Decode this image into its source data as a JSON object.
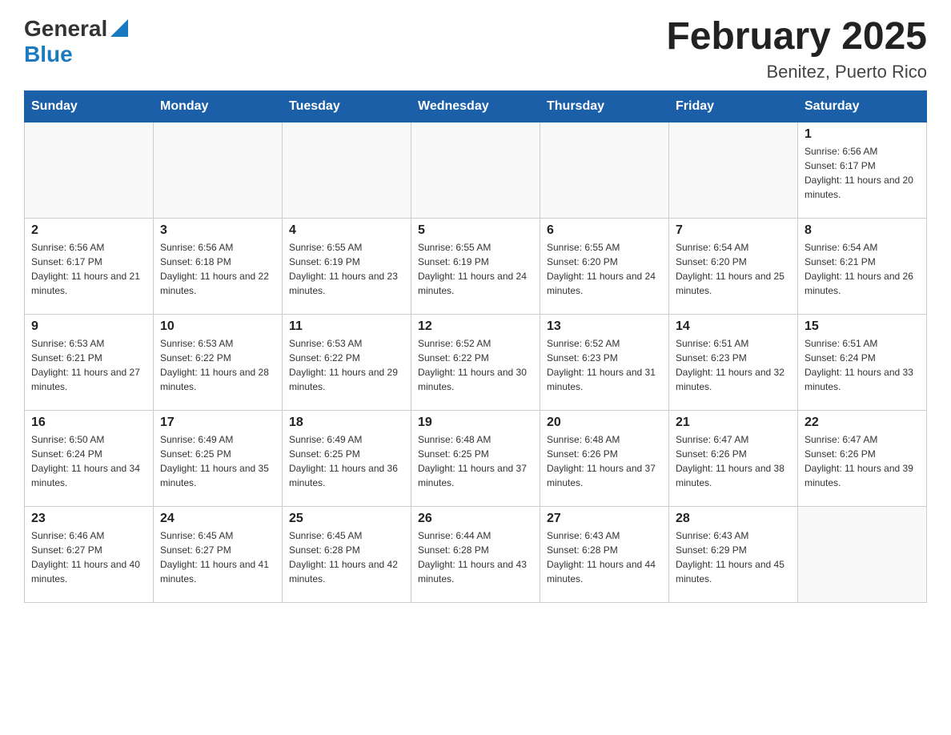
{
  "logo": {
    "text_general": "General",
    "text_blue": "Blue"
  },
  "header": {
    "month_year": "February 2025",
    "location": "Benitez, Puerto Rico"
  },
  "weekdays": [
    "Sunday",
    "Monday",
    "Tuesday",
    "Wednesday",
    "Thursday",
    "Friday",
    "Saturday"
  ],
  "weeks": [
    [
      {
        "day": "",
        "info": ""
      },
      {
        "day": "",
        "info": ""
      },
      {
        "day": "",
        "info": ""
      },
      {
        "day": "",
        "info": ""
      },
      {
        "day": "",
        "info": ""
      },
      {
        "day": "",
        "info": ""
      },
      {
        "day": "1",
        "info": "Sunrise: 6:56 AM\nSunset: 6:17 PM\nDaylight: 11 hours and 20 minutes."
      }
    ],
    [
      {
        "day": "2",
        "info": "Sunrise: 6:56 AM\nSunset: 6:17 PM\nDaylight: 11 hours and 21 minutes."
      },
      {
        "day": "3",
        "info": "Sunrise: 6:56 AM\nSunset: 6:18 PM\nDaylight: 11 hours and 22 minutes."
      },
      {
        "day": "4",
        "info": "Sunrise: 6:55 AM\nSunset: 6:19 PM\nDaylight: 11 hours and 23 minutes."
      },
      {
        "day": "5",
        "info": "Sunrise: 6:55 AM\nSunset: 6:19 PM\nDaylight: 11 hours and 24 minutes."
      },
      {
        "day": "6",
        "info": "Sunrise: 6:55 AM\nSunset: 6:20 PM\nDaylight: 11 hours and 24 minutes."
      },
      {
        "day": "7",
        "info": "Sunrise: 6:54 AM\nSunset: 6:20 PM\nDaylight: 11 hours and 25 minutes."
      },
      {
        "day": "8",
        "info": "Sunrise: 6:54 AM\nSunset: 6:21 PM\nDaylight: 11 hours and 26 minutes."
      }
    ],
    [
      {
        "day": "9",
        "info": "Sunrise: 6:53 AM\nSunset: 6:21 PM\nDaylight: 11 hours and 27 minutes."
      },
      {
        "day": "10",
        "info": "Sunrise: 6:53 AM\nSunset: 6:22 PM\nDaylight: 11 hours and 28 minutes."
      },
      {
        "day": "11",
        "info": "Sunrise: 6:53 AM\nSunset: 6:22 PM\nDaylight: 11 hours and 29 minutes."
      },
      {
        "day": "12",
        "info": "Sunrise: 6:52 AM\nSunset: 6:22 PM\nDaylight: 11 hours and 30 minutes."
      },
      {
        "day": "13",
        "info": "Sunrise: 6:52 AM\nSunset: 6:23 PM\nDaylight: 11 hours and 31 minutes."
      },
      {
        "day": "14",
        "info": "Sunrise: 6:51 AM\nSunset: 6:23 PM\nDaylight: 11 hours and 32 minutes."
      },
      {
        "day": "15",
        "info": "Sunrise: 6:51 AM\nSunset: 6:24 PM\nDaylight: 11 hours and 33 minutes."
      }
    ],
    [
      {
        "day": "16",
        "info": "Sunrise: 6:50 AM\nSunset: 6:24 PM\nDaylight: 11 hours and 34 minutes."
      },
      {
        "day": "17",
        "info": "Sunrise: 6:49 AM\nSunset: 6:25 PM\nDaylight: 11 hours and 35 minutes."
      },
      {
        "day": "18",
        "info": "Sunrise: 6:49 AM\nSunset: 6:25 PM\nDaylight: 11 hours and 36 minutes."
      },
      {
        "day": "19",
        "info": "Sunrise: 6:48 AM\nSunset: 6:25 PM\nDaylight: 11 hours and 37 minutes."
      },
      {
        "day": "20",
        "info": "Sunrise: 6:48 AM\nSunset: 6:26 PM\nDaylight: 11 hours and 37 minutes."
      },
      {
        "day": "21",
        "info": "Sunrise: 6:47 AM\nSunset: 6:26 PM\nDaylight: 11 hours and 38 minutes."
      },
      {
        "day": "22",
        "info": "Sunrise: 6:47 AM\nSunset: 6:26 PM\nDaylight: 11 hours and 39 minutes."
      }
    ],
    [
      {
        "day": "23",
        "info": "Sunrise: 6:46 AM\nSunset: 6:27 PM\nDaylight: 11 hours and 40 minutes."
      },
      {
        "day": "24",
        "info": "Sunrise: 6:45 AM\nSunset: 6:27 PM\nDaylight: 11 hours and 41 minutes."
      },
      {
        "day": "25",
        "info": "Sunrise: 6:45 AM\nSunset: 6:28 PM\nDaylight: 11 hours and 42 minutes."
      },
      {
        "day": "26",
        "info": "Sunrise: 6:44 AM\nSunset: 6:28 PM\nDaylight: 11 hours and 43 minutes."
      },
      {
        "day": "27",
        "info": "Sunrise: 6:43 AM\nSunset: 6:28 PM\nDaylight: 11 hours and 44 minutes."
      },
      {
        "day": "28",
        "info": "Sunrise: 6:43 AM\nSunset: 6:29 PM\nDaylight: 11 hours and 45 minutes."
      },
      {
        "day": "",
        "info": ""
      }
    ]
  ]
}
